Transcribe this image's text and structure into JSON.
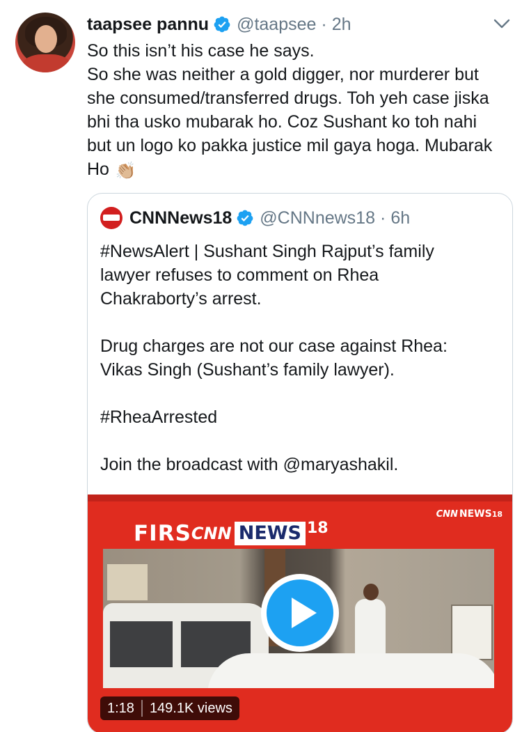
{
  "tweet": {
    "display_name": "taapsee pannu",
    "handle": "@taapsee",
    "separator": "·",
    "time": "2h",
    "avatar_icon": "profile-photo",
    "verified_icon": "verified-badge-icon",
    "menu_icon": "chevron-down-icon",
    "lines": [
      "So this isn’t his case he says.",
      "So she was neither a gold digger, nor murderer but",
      "she consumed/transferred drugs. Toh yeh case jiska",
      "bhi tha usko mubarak ho. Coz Sushant ko toh nahi",
      "but un logo ko pakka justice mil gaya hoga. Mubarak",
      "Ho"
    ],
    "emoji": "👏🏼"
  },
  "quote": {
    "display_name": "CNNNews18",
    "handle": "@CNNnews18",
    "separator": "·",
    "time": "6h",
    "logo_text": "CNN NEWS",
    "paragraphs": {
      "p1": [
        "#NewsAlert | Sushant Singh Rajput’s family",
        "lawyer refuses to comment on Rhea",
        "Chakraborty’s arrest."
      ],
      "p2": [
        "Drug charges are not our case against Rhea:",
        "Vikas Singh (Sushant’s family lawyer)."
      ],
      "p3": [
        "#RheaArrested"
      ],
      "p4": [
        "Join the broadcast with @maryashakil."
      ]
    },
    "media": {
      "brand_top_cnn": "CNN",
      "brand_top_news": "NEWS",
      "brand_top_18": "18",
      "bug_first": "FIRS",
      "bug_cnn": "CNN",
      "bug_news": "NEWS",
      "bug_18": "18",
      "duration": "1:18",
      "views": "149.1K views",
      "play_icon": "play-button-icon",
      "colors": {
        "background": "#e02c1f",
        "play": "#1da1f2"
      }
    }
  },
  "colors": {
    "text": "#14171a",
    "secondary": "#657786",
    "verified": "#1da1f2",
    "border": "#ccd6dd"
  }
}
